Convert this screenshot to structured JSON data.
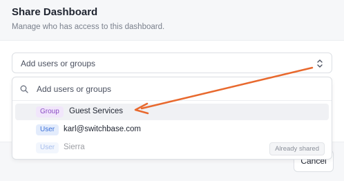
{
  "dialog": {
    "title": "Share Dashboard",
    "subtitle": "Manage who has access to this dashboard."
  },
  "select": {
    "placeholder": "Add users or groups",
    "icon": "chevron-up-down-icon"
  },
  "dropdown": {
    "search_placeholder": "Add users or groups",
    "search_icon": "search-icon",
    "options": [
      {
        "badge": "Group",
        "label": "Guest Services",
        "state": "highlighted"
      },
      {
        "badge": "User",
        "label": "karl@switchbase.com",
        "state": "normal"
      },
      {
        "badge": "User",
        "label": "Sierra",
        "state": "disabled",
        "tag": "Already shared"
      }
    ]
  },
  "footer": {
    "cancel_label": "Cancel"
  },
  "colors": {
    "annotation_arrow": "#e8692e",
    "group_badge_bg": "#f1e6fb",
    "user_badge_bg": "#e3ecfc"
  }
}
